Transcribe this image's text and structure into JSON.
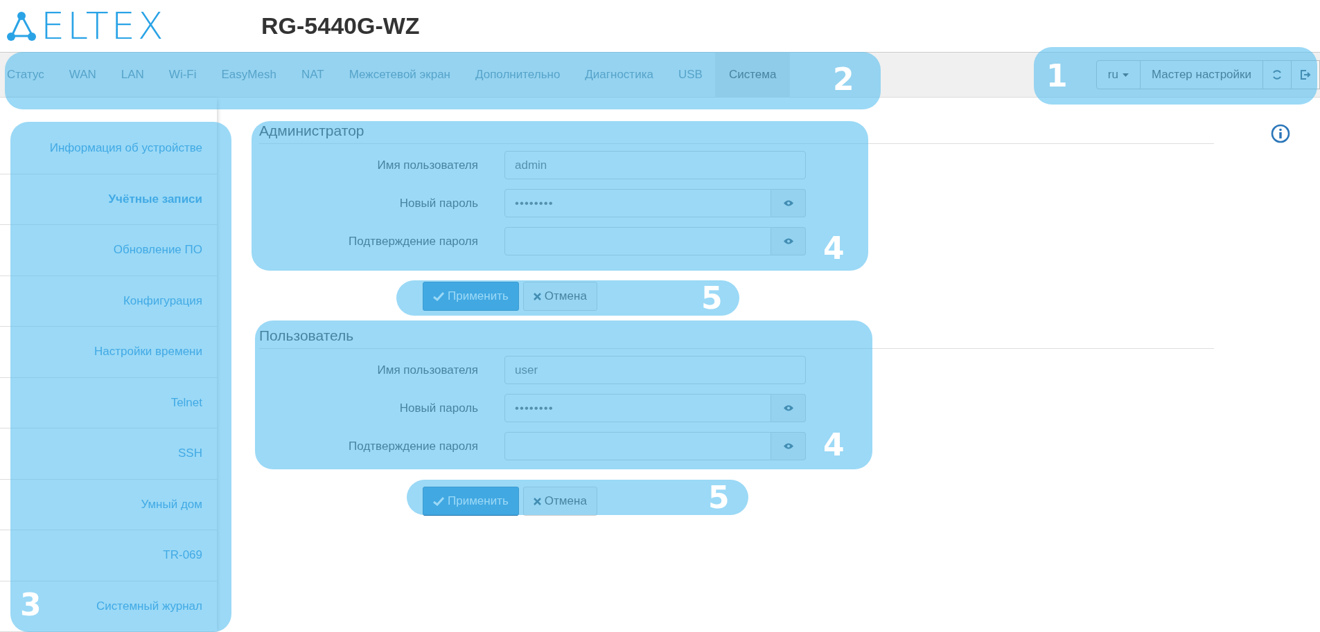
{
  "header": {
    "logo": "ELTEX",
    "model": "RG-5440G-WZ"
  },
  "nav": {
    "tabs": [
      {
        "label": "Статус",
        "selected": false
      },
      {
        "label": "WAN",
        "selected": false
      },
      {
        "label": "LAN",
        "selected": false
      },
      {
        "label": "Wi-Fi",
        "selected": false
      },
      {
        "label": "EasyMesh",
        "selected": false
      },
      {
        "label": "NAT",
        "selected": false
      },
      {
        "label": "Межсетевой экран",
        "selected": false
      },
      {
        "label": "Дополнительно",
        "selected": false
      },
      {
        "label": "Диагностика",
        "selected": false
      },
      {
        "label": "USB",
        "selected": false
      },
      {
        "label": "Система",
        "selected": true
      }
    ],
    "toolbar": {
      "language": "ru",
      "wizard": "Мастер настройки"
    }
  },
  "sidebar": {
    "items": [
      {
        "label": "Информация об устройстве",
        "selected": false
      },
      {
        "label": "Учётные записи",
        "selected": true
      },
      {
        "label": "Обновление ПО",
        "selected": false
      },
      {
        "label": "Конфигурация",
        "selected": false
      },
      {
        "label": "Настройки времени",
        "selected": false
      },
      {
        "label": "Telnet",
        "selected": false
      },
      {
        "label": "SSH",
        "selected": false
      },
      {
        "label": "Умный дом",
        "selected": false
      },
      {
        "label": "TR-069",
        "selected": false
      },
      {
        "label": "Системный журнал",
        "selected": false
      }
    ]
  },
  "sections": [
    {
      "title": "Администратор",
      "fields": [
        {
          "label": "Имя пользователя",
          "kind": "text",
          "value": "admin"
        },
        {
          "label": "Новый пароль",
          "kind": "password",
          "value": "••••••••"
        },
        {
          "label": "Подтверждение пароля",
          "kind": "password"
        }
      ],
      "apply": "Применить",
      "cancel": "Отмена"
    },
    {
      "title": "Пользователь",
      "fields": [
        {
          "label": "Имя пользователя",
          "kind": "text",
          "value": "user"
        },
        {
          "label": "Новый пароль",
          "kind": "password",
          "value": "••••••••"
        },
        {
          "label": "Подтверждение пароля",
          "kind": "password"
        }
      ],
      "apply": "Применить",
      "cancel": "Отмена"
    }
  ],
  "annotations": [
    {
      "number": "1"
    },
    {
      "number": "2"
    },
    {
      "number": "3"
    },
    {
      "number": "4"
    },
    {
      "number": "5"
    },
    {
      "number": "4"
    },
    {
      "number": "5"
    }
  ]
}
